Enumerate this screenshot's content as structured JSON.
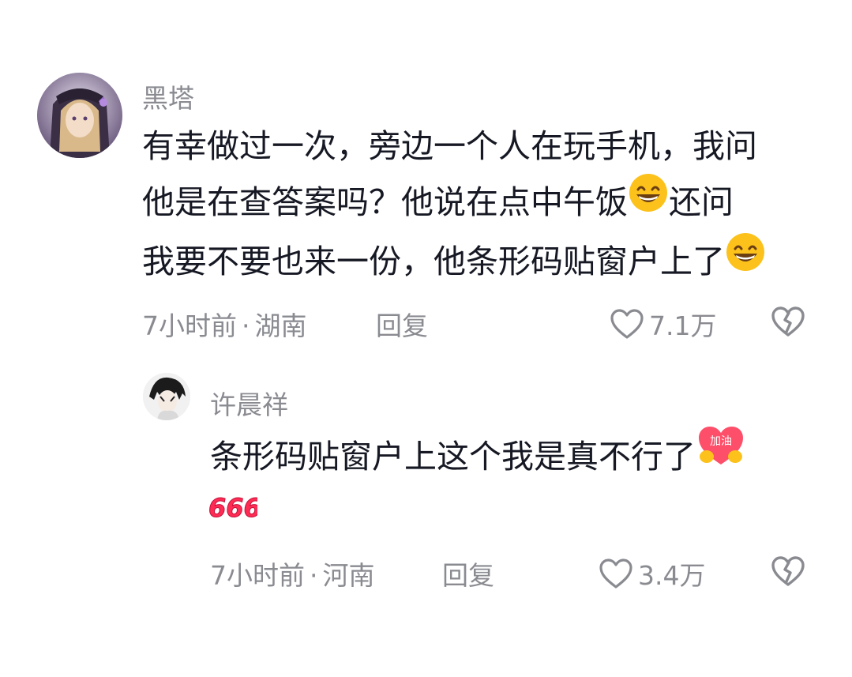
{
  "comments": [
    {
      "username": "黑塔",
      "lines": [
        "有幸做过一次，旁边一个人在玩手机，我问",
        "他是在查答案吗？他说在点中午饭",
        "还问",
        "我要不要也来一份，他条形码贴窗户上了"
      ],
      "time": "7小时前",
      "separator": "·",
      "location": "湖南",
      "reply_label": "回复",
      "likes": "7.1万",
      "emoji": "grinning-face"
    },
    {
      "username": "许晨祥",
      "lines": [
        "条形码贴窗户上这个我是真不行了"
      ],
      "sticker_text": "加油",
      "sticker_666": "666",
      "time": "7小时前",
      "separator": "·",
      "location": "河南",
      "reply_label": "回复",
      "likes": "3.4万"
    }
  ],
  "icons": {
    "like": "heart-outline-icon",
    "dislike": "broken-heart-icon"
  },
  "colors": {
    "text_primary": "#161823",
    "text_secondary": "#8a8b91",
    "accent_red": "#fe2c55"
  }
}
